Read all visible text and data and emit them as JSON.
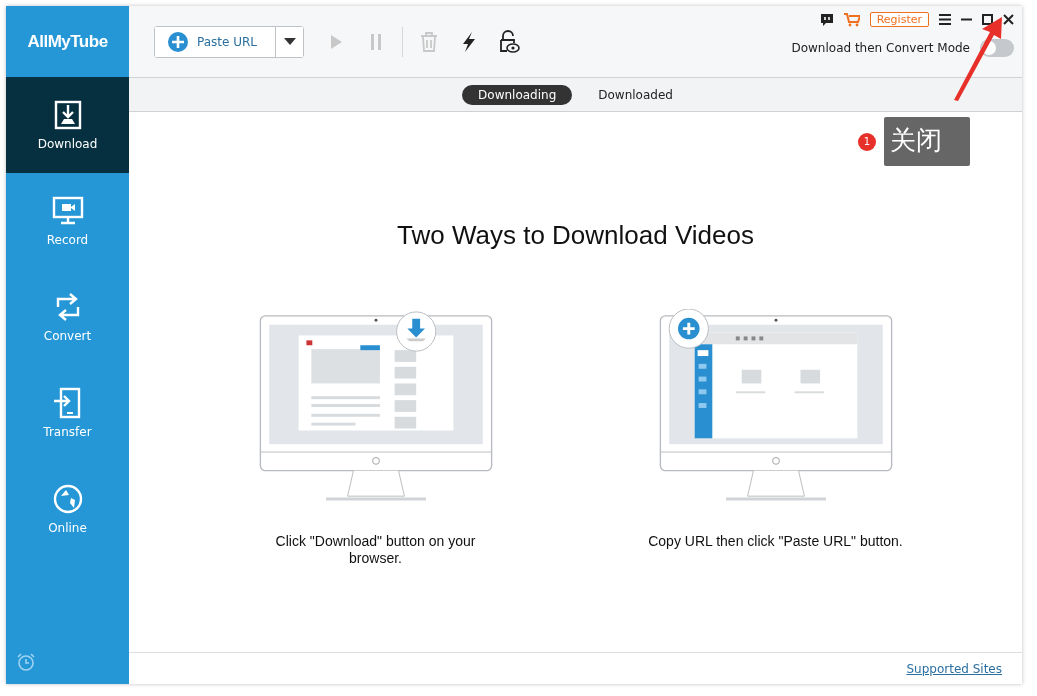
{
  "app": {
    "logo": "AllMyTube"
  },
  "sidebar": {
    "items": [
      {
        "label": "Download",
        "selected": true
      },
      {
        "label": "Record",
        "selected": false
      },
      {
        "label": "Convert",
        "selected": false
      },
      {
        "label": "Transfer",
        "selected": false
      },
      {
        "label": "Online",
        "selected": false
      }
    ]
  },
  "toolbar": {
    "paste_button": "Paste URL",
    "tools": [
      {
        "disabled": true
      },
      {
        "disabled": true
      },
      {
        "disabled": true
      },
      {
        "disabled": false
      },
      {
        "disabled": false
      }
    ]
  },
  "title_bar": {
    "register": "Register"
  },
  "mode_switch": {
    "label": "Download then Convert Mode",
    "on": false
  },
  "tabs": [
    {
      "label": "Downloading",
      "selected": true
    },
    {
      "label": "Downloaded",
      "selected": false
    }
  ],
  "content": {
    "heading": "Two Ways to Download Videos",
    "ways": [
      {
        "caption": "Click \"Download\" button on your browser."
      },
      {
        "caption": "Copy URL then click \"Paste URL\" button."
      }
    ]
  },
  "footer": {
    "link": "Supported Sites"
  },
  "annotation": {
    "number": "1",
    "text": "关闭"
  }
}
